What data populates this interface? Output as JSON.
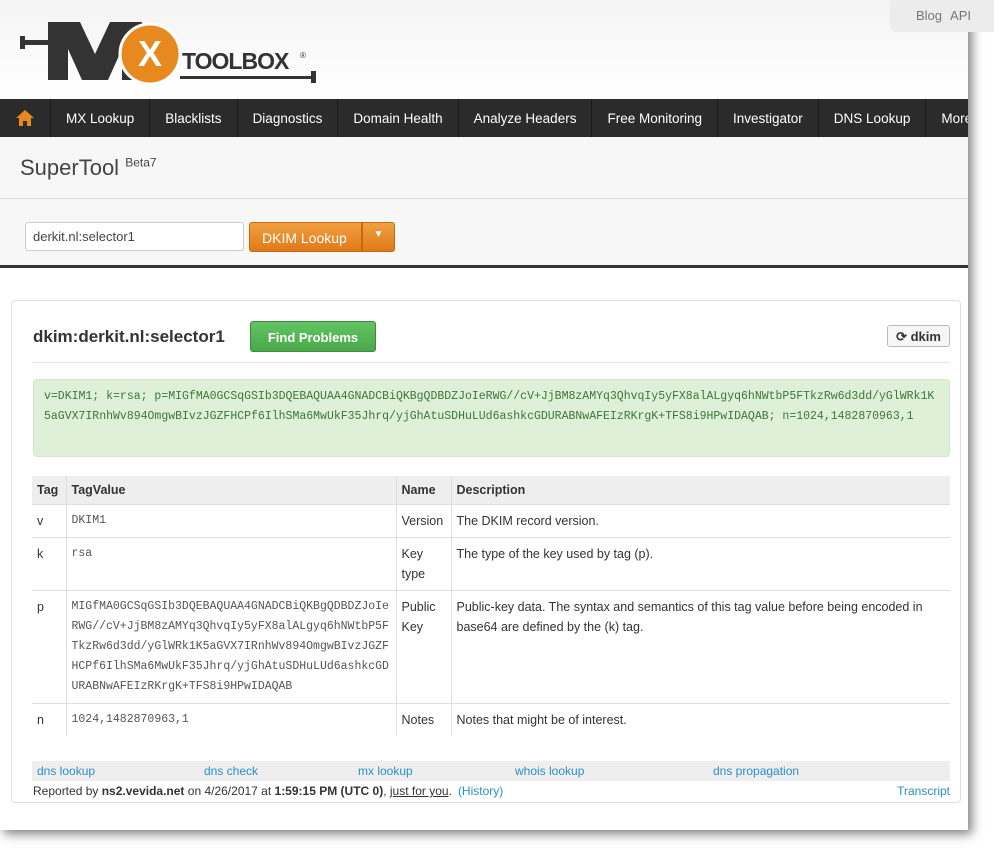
{
  "header": {
    "logo_text": "MX TOOLBOX",
    "top_links": [
      "Blog",
      "API"
    ]
  },
  "nav": {
    "items": [
      "MX Lookup",
      "Blacklists",
      "Diagnostics",
      "Domain Health",
      "Analyze Headers",
      "Free Monitoring",
      "Investigator",
      "DNS Lookup",
      "More"
    ]
  },
  "supertool": {
    "title": "SuperTool",
    "badge": "Beta7",
    "query": "derkit.nl:selector1",
    "lookup_label": "DKIM Lookup"
  },
  "result": {
    "title": "dkim:derkit.nl:selector1",
    "find_problems": "Find Problems",
    "refresh_label": "dkim",
    "record": "v=DKIM1; k=rsa; p=MIGfMA0GCSqGSIb3DQEBAQUAA4GNADCBiQKBgQDBDZJoIeRWG//cV+JjBM8zAMYq3QhvqIy5yFX8alALgyq6hNWtbP5FTkzRw6d3dd/yGlWRk1K5aGVX7IRnhWv894OmgwBIvzJGZFHCPf6IlhSMa6MwUkF35Jhrq/yjGhAtuSDHuLUd6ashkcGDURABNwAFEIzRKrgK+TFS8i9HPwIDAQAB; n=1024,1482870963,1",
    "columns": [
      "Tag",
      "TagValue",
      "Name",
      "Description"
    ],
    "rows": [
      {
        "tag": "v",
        "value": "DKIM1",
        "name": "Version",
        "desc": "The DKIM record version."
      },
      {
        "tag": "k",
        "value": "rsa",
        "name": "Key type",
        "desc": "The type of the key used by tag (p)."
      },
      {
        "tag": "p",
        "value": "MIGfMA0GCSqGSIb3DQEBAQUAA4GNADCBiQKBgQDBDZJoIeRWG//cV+JjBM8zAMYq3QhvqIy5yFX8alALgyq6hNWtbP5FTkzRw6d3dd/yGlWRk1K5aGVX7IRnhWv894OmgwBIvzJGZFHCPf6IlhSMa6MwUkF35Jhrq/yjGhAtuSDHuLUd6ashkcGDURABNwAFEIzRKrgK+TFS8i9HPwIDAQAB",
        "name": "Public Key",
        "desc": "Public-key data. The syntax and semantics of this tag value before being encoded in base64 are defined by the (k) tag."
      },
      {
        "tag": "n",
        "value": "1024,1482870963,1",
        "name": "Notes",
        "desc": "Notes that might be of interest."
      }
    ],
    "links": [
      "dns lookup",
      "dns check",
      "mx lookup",
      "whois lookup",
      "dns propagation"
    ],
    "report": {
      "prefix": "Reported by ",
      "server": "ns2.vevida.net",
      "on": " on 4/26/2017 at ",
      "time": "1:59:15 PM (UTC 0)",
      "comma": ", ",
      "just": "just for you",
      "dot": ".",
      "history": "(History)",
      "transcript": "Transcript"
    }
  },
  "colors": {
    "nav_bg": "#2b2b2b",
    "accent_orange": "#e8891f",
    "success_green": "#5cb85c",
    "record_bg": "#dff0d8",
    "link": "#2a8fc8"
  }
}
